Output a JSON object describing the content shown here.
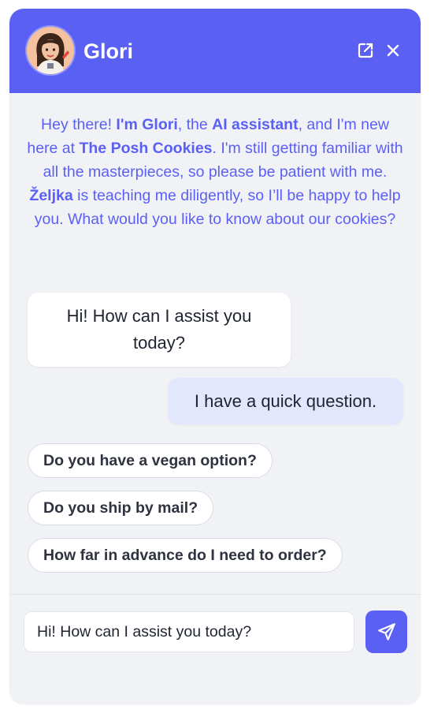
{
  "header": {
    "title": "Glori",
    "avatar_icon": "assistant-avatar",
    "expand_icon": "external-link-icon",
    "close_icon": "close-icon",
    "background_color": "#5b60f4"
  },
  "intro": {
    "p1": "Hey there! ",
    "name": "I'm Glori",
    "p2": ", the ",
    "role": "AI assistant",
    "p3": ", and I'm new here at ",
    "company": "The Posh Cookies",
    "p4": ". I'm still getting familiar with all the masterpieces, so please be patient with me. ",
    "teacher": "Željka",
    "p5": " is teaching me diligently, so I’ll be happy to help you. What would you like to know about our cookies?"
  },
  "messages": {
    "bot": "Hi! How can I assist you today?",
    "user": "I have a quick question."
  },
  "suggestions": [
    "Do you have a vegan option?",
    "Do you ship by mail?",
    "How far in advance do I need to order?"
  ],
  "composer": {
    "input_value": "Hi! How can I assist you today?",
    "send_icon": "send-icon"
  }
}
